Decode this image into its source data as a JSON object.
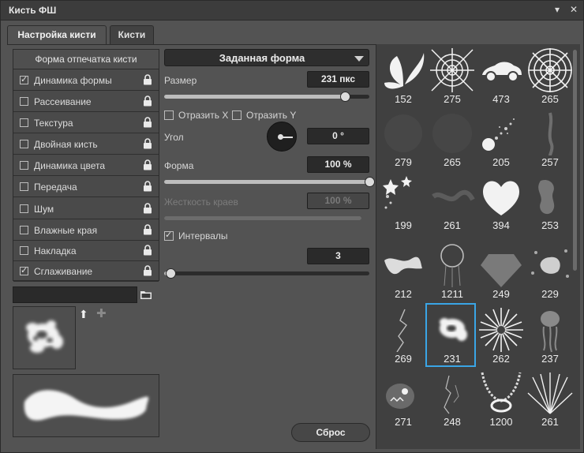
{
  "window": {
    "title": "Кисть ФШ"
  },
  "tabs": [
    {
      "label": "Настройка кисти"
    },
    {
      "label": "Кисти"
    }
  ],
  "left": {
    "header": "Форма отпечатка кисти",
    "items": [
      {
        "label": "Динамика формы",
        "checked": true
      },
      {
        "label": "Рассеивание",
        "checked": false
      },
      {
        "label": "Текстура",
        "checked": false
      },
      {
        "label": "Двойная кисть",
        "checked": false
      },
      {
        "label": "Динамика цвета",
        "checked": false
      },
      {
        "label": "Передача",
        "checked": false
      },
      {
        "label": "Шум",
        "checked": false
      },
      {
        "label": "Влажные края",
        "checked": false
      },
      {
        "label": "Накладка",
        "checked": false
      },
      {
        "label": "Сглаживание",
        "checked": true
      }
    ],
    "path_value": ""
  },
  "settings": {
    "shape_dropdown": "Заданная форма",
    "size": {
      "label": "Размер",
      "value": "231 пкс",
      "slider": 0.88
    },
    "flip_x": {
      "label": "Отразить X",
      "checked": false
    },
    "flip_y": {
      "label": "Отразить Y",
      "checked": false
    },
    "angle": {
      "label": "Угол",
      "value": "0 °"
    },
    "roundness": {
      "label": "Форма",
      "value": "100 %",
      "slider": 1.0
    },
    "hardness": {
      "label": "Жесткость краев",
      "value": "100 %",
      "slider": 1.0
    },
    "spacing": {
      "label": "Интервалы",
      "checked": true,
      "value": "3",
      "slider": 0.03
    },
    "reset_label": "Сброс"
  },
  "brushes": {
    "items": [
      "152",
      "275",
      "473",
      "265",
      "279",
      "265",
      "205",
      "257",
      "199",
      "261",
      "394",
      "253",
      "212",
      "1211",
      "249",
      "229",
      "269",
      "231",
      "262",
      "237",
      "271",
      "248",
      "1200",
      "261"
    ],
    "selected": "231"
  },
  "colors": {
    "accent": "#3aa5e6",
    "background": "#535353",
    "dark_field": "#2a2a2a"
  },
  "icons": {
    "lock": "lock-icon",
    "folder": "folder-icon",
    "upload": "upload-icon",
    "add": "plus-icon"
  }
}
